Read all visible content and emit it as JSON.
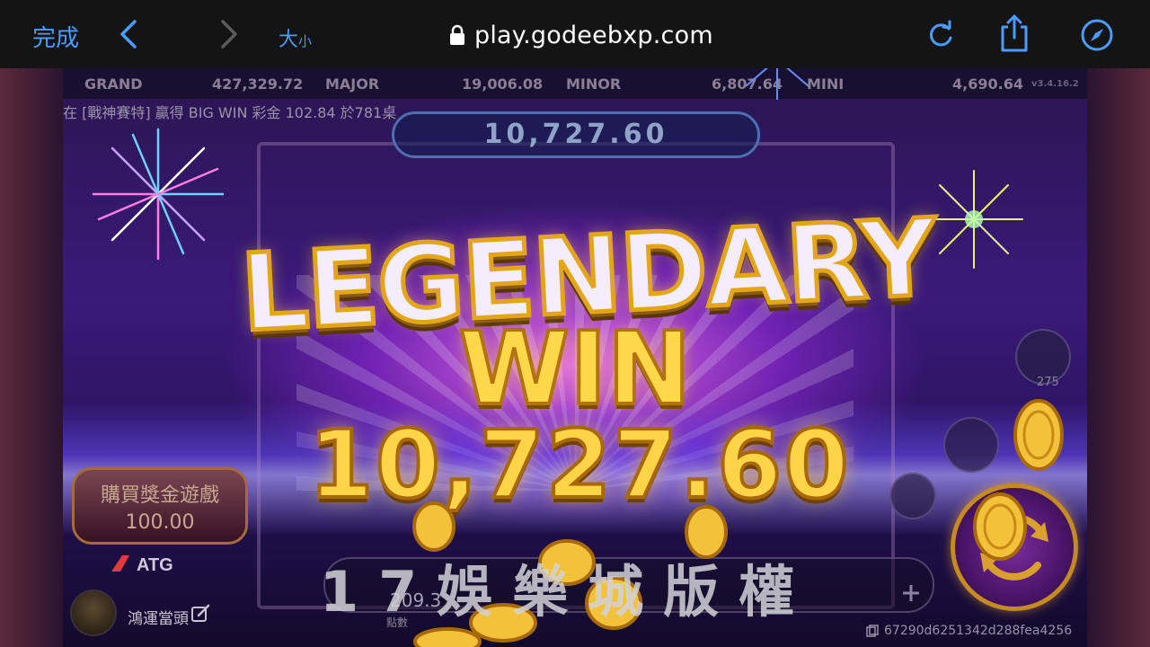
{
  "browser": {
    "done_label": "完成",
    "text_size_big": "大",
    "text_size_small": "小",
    "url": "play.godeebxp.com",
    "icons": [
      "back-chevron-icon",
      "forward-chevron-icon",
      "lock-icon",
      "reload-icon",
      "share-icon",
      "compass-icon"
    ],
    "accent_color": "#4a9cff"
  },
  "jackpots": [
    {
      "label": "GRAND",
      "value": "427,329.72"
    },
    {
      "label": "MAJOR",
      "value": "19,006.08"
    },
    {
      "label": "MINOR",
      "value": "6,807.64"
    },
    {
      "label": "MINI",
      "value": "4,690.64"
    }
  ],
  "version": "v3.4.16.2",
  "ticker_text": "在 [戰神賽特] 贏得 BIG WIN 彩金 102.84 於781桌",
  "total_win_box": "10,727.60",
  "win_banner": {
    "title": "LEGENDARY",
    "subtitle": "WIN",
    "amount": "10,727.60"
  },
  "buy_feature": {
    "label": "購買獎金遊戲",
    "price": "100.00"
  },
  "logo_text": "ATG",
  "player": {
    "name": "鴻運當頭"
  },
  "balance": {
    "value": "209.3",
    "label": "點數"
  },
  "watermark": "17娛樂城版權",
  "spin_count": "275",
  "session_id": "67290d6251342d288fea4256"
}
